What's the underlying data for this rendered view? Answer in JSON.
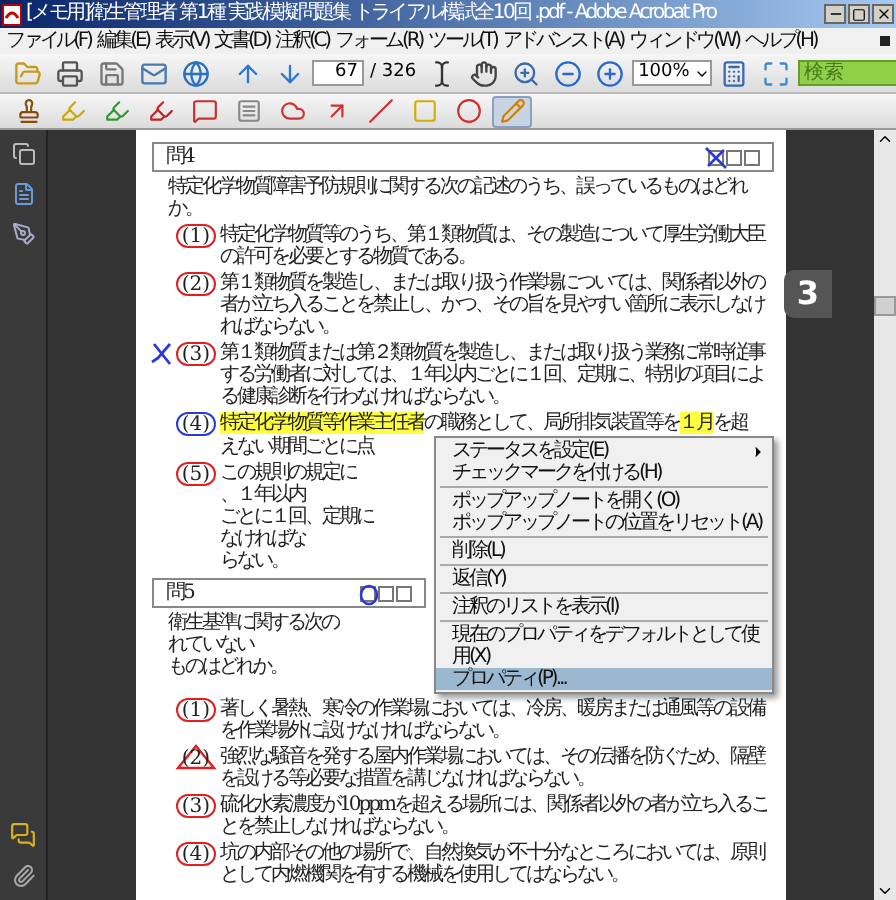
{
  "window": {
    "title": "[メモ用]衛生管理者 第1種 実践模擬問題集 トライアル模試全10回 .pdf - Adobe Acrobat Pro"
  },
  "menu_bar": [
    "ファイル(F)",
    "編集(E)",
    "表示(V)",
    "文書(D)",
    "注釈(C)",
    "フォーム(R)",
    "ツール(T)",
    "アドバンスト(A)",
    "ウィンドウ(W)",
    "ヘルプ(H)"
  ],
  "toolbar": {
    "page_current": "67",
    "page_total": "/ 326",
    "zoom": "100%",
    "search_placeholder": "検索"
  },
  "annotation_tools": [
    {
      "kind": "stamp",
      "selected": false
    },
    {
      "kind": "note-yellow",
      "selected": false
    },
    {
      "kind": "note-green",
      "selected": false
    },
    {
      "kind": "note-red",
      "selected": false
    },
    {
      "kind": "callout",
      "selected": false
    },
    {
      "kind": "textbox",
      "selected": false
    },
    {
      "kind": "cloud",
      "selected": false
    },
    {
      "kind": "arrow",
      "selected": false
    },
    {
      "kind": "line",
      "selected": false
    },
    {
      "kind": "rectangle",
      "selected": false
    },
    {
      "kind": "oval",
      "selected": false
    },
    {
      "kind": "pencil",
      "selected": true
    }
  ],
  "page_tab": "3",
  "questions": [
    {
      "title": "問4",
      "header_under_menu": false,
      "answer_boxes": [
        {
          "crossed": true,
          "circled": false
        },
        {
          "crossed": false,
          "circled": false
        },
        {
          "crossed": false,
          "circled": false
        }
      ],
      "stem": [
        {
          "segments": [
            {
              "text": "特定化学物質障害予防規則に関する次の記述のうち、誤っているものはどれか。",
              "highlight": false
            }
          ],
          "under_menu": false
        }
      ],
      "items": [
        {
          "number": "(1)",
          "circled": true,
          "triangled": false,
          "color": "#e02020",
          "crossed": false,
          "lines": [
            {
              "segments": [
                {
                  "text": "特定化学物質等のうち、第１類物質は、その製造について厚生労働大臣の許可を必要とする物質である。",
                  "highlight": false
                }
              ],
              "under_menu": false
            }
          ]
        },
        {
          "number": "(2)",
          "circled": true,
          "triangled": false,
          "color": "#e02020",
          "crossed": false,
          "lines": [
            {
              "segments": [
                {
                  "text": "第１類物質を製造し、または取り扱う作業場については、関係者以外の者が立ち入ることを禁止し、かつ、その旨を見やすい箇所に表示しなければならない。",
                  "highlight": false
                }
              ],
              "under_menu": false
            }
          ]
        },
        {
          "number": "(3)",
          "circled": true,
          "triangled": false,
          "color": "#e02020",
          "crossed": true,
          "lines": [
            {
              "segments": [
                {
                  "text": "第１類物質または第２類物質を製造し、または取り扱う業務に常時従事する労働者に対しては、１年以内ごとに１回、定期に、特別の項目による健康診断を行わなければならない。",
                  "highlight": false
                }
              ],
              "under_menu": false
            }
          ]
        },
        {
          "number": "(4)",
          "circled": true,
          "triangled": false,
          "color": "#2a3ad8",
          "crossed": false,
          "lines": [
            {
              "segments": [
                {
                  "text": "特定化学物質等作業主任者",
                  "highlight": true
                },
                {
                  "text": "の職務として、局所排気装置等を",
                  "highlight": false
                },
                {
                  "text": "１月",
                  "highlight": true
                },
                {
                  "text": "を超",
                  "highlight": false
                }
              ],
              "under_menu": false
            },
            {
              "segments": [
                {
                  "text": "えない期間ごとに点",
                  "highlight": false
                }
              ],
              "under_menu": true
            }
          ]
        },
        {
          "number": "(5)",
          "circled": true,
          "triangled": false,
          "color": "#e02020",
          "crossed": false,
          "lines": [
            {
              "segments": [
                {
                  "text": "この規則の規定に",
                  "highlight": false
                }
              ],
              "tail": "、１年以内",
              "under_menu": true
            },
            {
              "segments": [
                {
                  "text": "ごとに１回、定期に",
                  "highlight": false
                }
              ],
              "tail": "なければな",
              "under_menu": true
            },
            {
              "segments": [
                {
                  "text": "らない。",
                  "highlight": false
                }
              ],
              "under_menu": true
            }
          ]
        }
      ]
    },
    {
      "title": "問5",
      "header_under_menu": true,
      "answer_boxes": [
        {
          "crossed": false,
          "circled": true
        },
        {
          "crossed": false,
          "circled": false
        },
        {
          "crossed": false,
          "circled": false
        }
      ],
      "stem": [
        {
          "segments": [
            {
              "text": "衛生基準に関する次の",
              "highlight": false
            }
          ],
          "tail": "れていない",
          "under_menu": true
        },
        {
          "segments": [
            {
              "text": "ものはどれか。",
              "highlight": false
            }
          ],
          "under_menu": true
        }
      ],
      "items": [
        {
          "number": "(1)",
          "circled": true,
          "triangled": false,
          "color": "#e02020",
          "crossed": false,
          "lines": [
            {
              "segments": [
                {
                  "text": "著しく暑熱、寒冷の作業場においては、冷房、暖房または通風等の設備を作業場外に設けなければならない。",
                  "highlight": false
                }
              ],
              "under_menu": false
            }
          ]
        },
        {
          "number": "(2)",
          "circled": false,
          "triangled": true,
          "color": "#e02020",
          "crossed": false,
          "lines": [
            {
              "segments": [
                {
                  "text": "強烈な騒音を発する屋内作業場においては、その伝播を防ぐため、隔壁を設ける等必要な措置を講じなければならない。",
                  "highlight": false
                }
              ],
              "under_menu": false
            }
          ]
        },
        {
          "number": "(3)",
          "circled": true,
          "triangled": false,
          "color": "#e02020",
          "crossed": false,
          "lines": [
            {
              "segments": [
                {
                  "text": "硫化水素濃度が10ppmを超える場所には、関係者以外の者が立ち入ることを禁止しなければならない。",
                  "highlight": false
                }
              ],
              "under_menu": false
            }
          ]
        },
        {
          "number": "(4)",
          "circled": true,
          "triangled": false,
          "color": "#e02020",
          "crossed": false,
          "lines": [
            {
              "segments": [
                {
                  "text": "坑の内部その他の場所で、自然換気が不十分なところにおいては、原則として内燃機関を有する機械を使用してはならない。",
                  "highlight": false
                }
              ],
              "under_menu": false
            }
          ]
        }
      ]
    }
  ],
  "context_menu": [
    {
      "label": "ステータスを設定(E)",
      "submenu": true,
      "separator_before": false,
      "selected": false
    },
    {
      "label": "チェックマークを付ける(H)",
      "submenu": false,
      "separator_before": false,
      "selected": false
    },
    {
      "label": "ポップアップノートを開く(O)",
      "submenu": false,
      "separator_before": true,
      "selected": false
    },
    {
      "label": "ポップアップノートの位置をリセット(A)",
      "submenu": false,
      "separator_before": false,
      "selected": false
    },
    {
      "label": "削除(L)",
      "submenu": false,
      "separator_before": true,
      "selected": false
    },
    {
      "label": "返信(Y)",
      "submenu": false,
      "separator_before": true,
      "selected": false
    },
    {
      "label": "注釈のリストを表示(I)",
      "submenu": false,
      "separator_before": true,
      "selected": false
    },
    {
      "label": "現在のプロパティをデフォルトとして使用(X)",
      "submenu": false,
      "separator_before": true,
      "selected": false
    },
    {
      "label": "プロパティ(P)...",
      "submenu": false,
      "separator_before": false,
      "selected": true
    }
  ]
}
